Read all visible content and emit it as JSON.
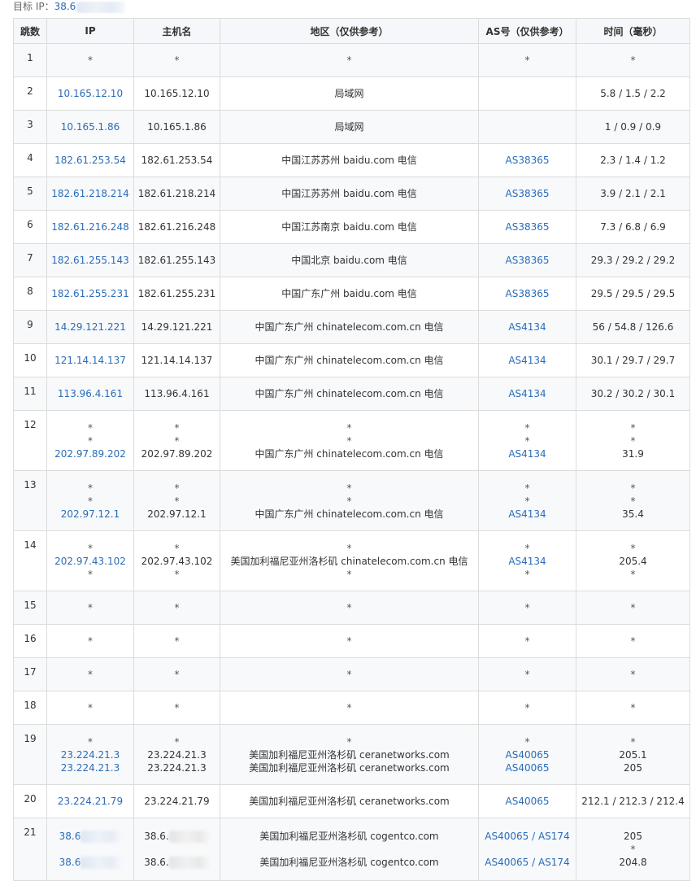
{
  "target": {
    "label": "目标 IP：",
    "ip_visible": "38.6"
  },
  "columns": [
    "跳数",
    "IP",
    "主机名",
    "地区（仅供参考）",
    "AS号（仅供参考）",
    "时间（毫秒）"
  ],
  "rows": [
    {
      "hop": "1",
      "ip": [
        "*"
      ],
      "host": [
        "*"
      ],
      "region": [
        "*"
      ],
      "as": [
        "*"
      ],
      "time": [
        "*"
      ]
    },
    {
      "hop": "2",
      "ip": [
        "10.165.12.10"
      ],
      "host": [
        "10.165.12.10"
      ],
      "region": [
        "局域网"
      ],
      "as": [
        ""
      ],
      "time": [
        "5.8 / 1.5 / 2.2"
      ]
    },
    {
      "hop": "3",
      "ip": [
        "10.165.1.86"
      ],
      "host": [
        "10.165.1.86"
      ],
      "region": [
        "局域网"
      ],
      "as": [
        ""
      ],
      "time": [
        "1 / 0.9 / 0.9"
      ]
    },
    {
      "hop": "4",
      "ip": [
        "182.61.253.54"
      ],
      "host": [
        "182.61.253.54"
      ],
      "region": [
        "中国江苏苏州 baidu.com 电信"
      ],
      "as": [
        "AS38365"
      ],
      "time": [
        "2.3 / 1.4 / 1.2"
      ]
    },
    {
      "hop": "5",
      "ip": [
        "182.61.218.214"
      ],
      "host": [
        "182.61.218.214"
      ],
      "region": [
        "中国江苏苏州 baidu.com 电信"
      ],
      "as": [
        "AS38365"
      ],
      "time": [
        "3.9 / 2.1 / 2.1"
      ]
    },
    {
      "hop": "6",
      "ip": [
        "182.61.216.248"
      ],
      "host": [
        "182.61.216.248"
      ],
      "region": [
        "中国江苏南京 baidu.com 电信"
      ],
      "as": [
        "AS38365"
      ],
      "time": [
        "7.3 / 6.8 / 6.9"
      ]
    },
    {
      "hop": "7",
      "ip": [
        "182.61.255.143"
      ],
      "host": [
        "182.61.255.143"
      ],
      "region": [
        "中国北京 baidu.com 电信"
      ],
      "as": [
        "AS38365"
      ],
      "time": [
        "29.3 / 29.2 / 29.2"
      ]
    },
    {
      "hop": "8",
      "ip": [
        "182.61.255.231"
      ],
      "host": [
        "182.61.255.231"
      ],
      "region": [
        "中国广东广州 baidu.com 电信"
      ],
      "as": [
        "AS38365"
      ],
      "time": [
        "29.5 / 29.5 / 29.5"
      ]
    },
    {
      "hop": "9",
      "ip": [
        "14.29.121.221"
      ],
      "host": [
        "14.29.121.221"
      ],
      "region": [
        "中国广东广州 chinatelecom.com.cn 电信"
      ],
      "as": [
        "AS4134"
      ],
      "time": [
        "56 / 54.8 / 126.6"
      ]
    },
    {
      "hop": "10",
      "ip": [
        "121.14.14.137"
      ],
      "host": [
        "121.14.14.137"
      ],
      "region": [
        "中国广东广州 chinatelecom.com.cn 电信"
      ],
      "as": [
        "AS4134"
      ],
      "time": [
        "30.1 / 29.7 / 29.7"
      ]
    },
    {
      "hop": "11",
      "ip": [
        "113.96.4.161"
      ],
      "host": [
        "113.96.4.161"
      ],
      "region": [
        "中国广东广州 chinatelecom.com.cn 电信"
      ],
      "as": [
        "AS4134"
      ],
      "time": [
        "30.2 / 30.2 / 30.1"
      ]
    },
    {
      "hop": "12",
      "ip": [
        "*",
        "*",
        "202.97.89.202"
      ],
      "host": [
        "*",
        "*",
        "202.97.89.202"
      ],
      "region": [
        "*",
        "*",
        "中国广东广州 chinatelecom.com.cn 电信"
      ],
      "as": [
        "*",
        "*",
        "AS4134"
      ],
      "time": [
        "*",
        "*",
        "31.9"
      ]
    },
    {
      "hop": "13",
      "ip": [
        "*",
        "*",
        "202.97.12.1"
      ],
      "host": [
        "*",
        "*",
        "202.97.12.1"
      ],
      "region": [
        "*",
        "*",
        "中国广东广州 chinatelecom.com.cn 电信"
      ],
      "as": [
        "*",
        "*",
        "AS4134"
      ],
      "time": [
        "*",
        "*",
        "35.4"
      ]
    },
    {
      "hop": "14",
      "ip": [
        "*",
        "202.97.43.102",
        "*"
      ],
      "host": [
        "*",
        "202.97.43.102",
        "*"
      ],
      "region": [
        "*",
        "美国加利福尼亚州洛杉矶 chinatelecom.com.cn 电信",
        "*"
      ],
      "as": [
        "*",
        "AS4134",
        "*"
      ],
      "time": [
        "*",
        "205.4",
        "*"
      ]
    },
    {
      "hop": "15",
      "ip": [
        "*"
      ],
      "host": [
        "*"
      ],
      "region": [
        "*"
      ],
      "as": [
        "*"
      ],
      "time": [
        "*"
      ]
    },
    {
      "hop": "16",
      "ip": [
        "*"
      ],
      "host": [
        "*"
      ],
      "region": [
        "*"
      ],
      "as": [
        "*"
      ],
      "time": [
        "*"
      ]
    },
    {
      "hop": "17",
      "ip": [
        "*"
      ],
      "host": [
        "*"
      ],
      "region": [
        "*"
      ],
      "as": [
        "*"
      ],
      "time": [
        "*"
      ]
    },
    {
      "hop": "18",
      "ip": [
        "*"
      ],
      "host": [
        "*"
      ],
      "region": [
        "*"
      ],
      "as": [
        "*"
      ],
      "time": [
        "*"
      ]
    },
    {
      "hop": "19",
      "ip": [
        "*",
        "23.224.21.3",
        "23.224.21.3"
      ],
      "host": [
        "*",
        "23.224.21.3",
        "23.224.21.3"
      ],
      "region": [
        "*",
        "美国加利福尼亚州洛杉矶 ceranetworks.com",
        "美国加利福尼亚州洛杉矶 ceranetworks.com"
      ],
      "as": [
        "*",
        "AS40065",
        "AS40065"
      ],
      "time": [
        "*",
        "205.1",
        "205"
      ]
    },
    {
      "hop": "20",
      "ip": [
        "23.224.21.79"
      ],
      "host": [
        "23.224.21.79"
      ],
      "region": [
        "美国加利福尼亚州洛杉矶 ceranetworks.com"
      ],
      "as": [
        "AS40065"
      ],
      "time": [
        "212.1 / 212.3 / 212.4"
      ]
    },
    {
      "hop": "21",
      "ip": [
        "38.6",
        "",
        "38.6"
      ],
      "host": [
        "38.6.",
        "",
        "38.6."
      ],
      "region": [
        "美国加利福尼亚州洛杉矶 cogentco.com",
        "",
        "美国加利福尼亚州洛杉矶 cogentco.com"
      ],
      "as": [
        "AS40065 / AS174",
        "",
        "AS40065 / AS174"
      ],
      "time": [
        "205",
        "*",
        "204.8"
      ]
    }
  ]
}
